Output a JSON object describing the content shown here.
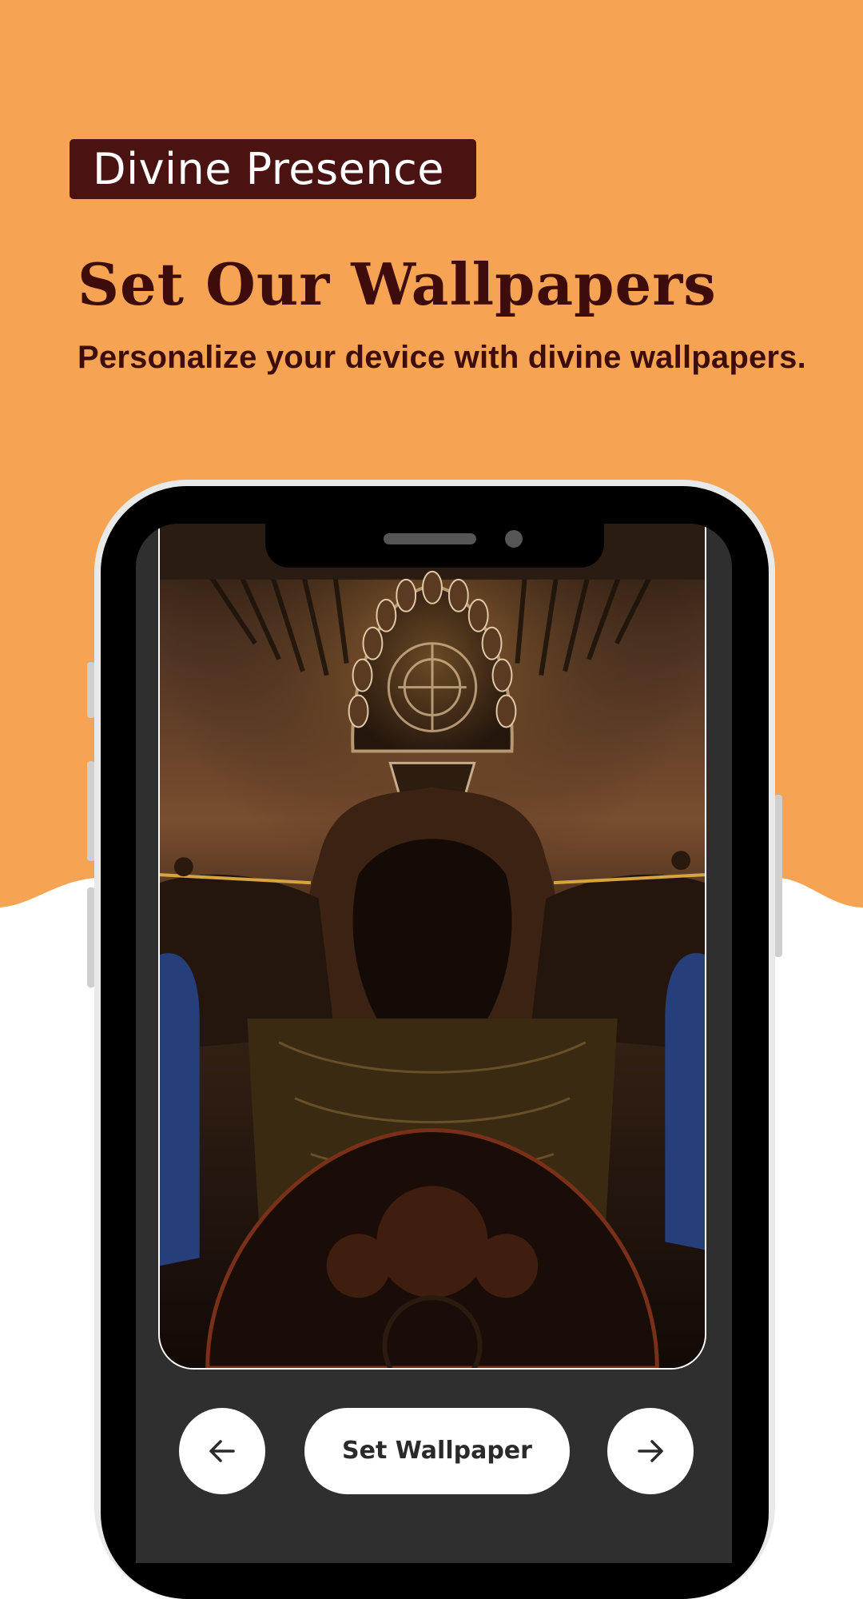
{
  "colors": {
    "background_orange": "#f6a453",
    "background_white": "#ffffff",
    "badge_bg": "#4a1210",
    "text_dark_maroon": "#3d0c0b",
    "phone_body": "#000000",
    "phone_frame": "#e9e9e9",
    "screen_panel": "#2f2f2f",
    "button_bg": "#ffffff"
  },
  "header": {
    "badge_label": "Divine Presence",
    "headline": "Set Our Wallpapers",
    "subheadline": "Personalize your device with divine wallpapers."
  },
  "phone_preview": {
    "wallpaper_icon": "deity-wallpaper-image",
    "controls": {
      "prev_icon": "arrow-left-icon",
      "set_wallpaper_label": "Set Wallpaper",
      "next_icon": "arrow-right-icon"
    }
  }
}
